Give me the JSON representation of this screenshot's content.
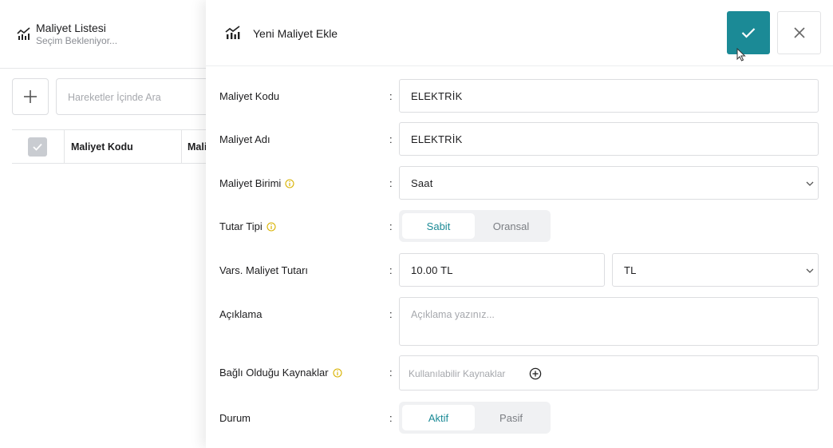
{
  "list_panel": {
    "title": "Maliyet Listesi",
    "subtitle": "Seçim Bekleniyor...",
    "search_placeholder": "Hareketler İçinde Ara",
    "columns": [
      "Maliyet Kodu",
      "Mali"
    ]
  },
  "drawer": {
    "title": "Yeni Maliyet Ekle",
    "accent_color": "#1b8a96",
    "fields": {
      "code": {
        "label": "Maliyet Kodu",
        "value": "ELEKTRİK"
      },
      "name": {
        "label": "Maliyet Adı",
        "value": "ELEKTRİK"
      },
      "unit": {
        "label": "Maliyet Birimi",
        "value": "Saat"
      },
      "amount_type": {
        "label": "Tutar Tipi",
        "options": [
          "Sabit",
          "Oransal"
        ],
        "selected": "Sabit"
      },
      "default_amount": {
        "label": "Vars. Maliyet Tutarı",
        "value": "10.00 TL",
        "currency": "TL"
      },
      "description": {
        "label": "Açıklama",
        "placeholder": "Açıklama yazınız..."
      },
      "resources": {
        "label": "Bağlı Olduğu Kaynaklar",
        "placeholder": "Kullanılabilir Kaynaklar"
      },
      "status": {
        "label": "Durum",
        "options": [
          "Aktif",
          "Pasif"
        ],
        "selected": "Aktif"
      }
    },
    "separator": ":"
  },
  "icons": {
    "list_icon": "chart-bars-icon",
    "drawer_icon": "chart-bars-icon",
    "confirm": "check-icon",
    "close": "close-icon",
    "info": "info-icon",
    "add": "plus-icon",
    "resources_add": "plus-circle-icon",
    "select": "chevron-down-icon"
  }
}
